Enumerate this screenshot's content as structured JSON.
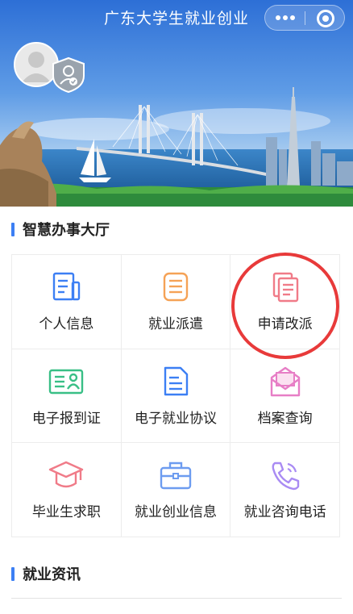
{
  "header": {
    "title": "广东大学生就业创业",
    "more_icon": "more-dots-icon",
    "close_icon": "target-close-icon"
  },
  "profile": {
    "avatar_icon": "user-avatar-icon",
    "badge_icon": "verified-shield-icon"
  },
  "sections": {
    "hall_title": "智慧办事大厅",
    "news_title": "就业资讯"
  },
  "grid": {
    "items": [
      {
        "label": "个人信息",
        "icon": "document-icon",
        "color": "#3c7ff4"
      },
      {
        "label": "就业派遣",
        "icon": "list-document-icon",
        "color": "#f5a256"
      },
      {
        "label": "申请改派",
        "icon": "copy-document-icon",
        "color": "#f07b88"
      },
      {
        "label": "电子报到证",
        "icon": "id-card-icon",
        "color": "#39bf86"
      },
      {
        "label": "电子就业协议",
        "icon": "agreement-document-icon",
        "color": "#3c7ff4"
      },
      {
        "label": "档案查询",
        "icon": "envelope-icon",
        "color": "#e77ec6"
      },
      {
        "label": "毕业生求职",
        "icon": "graduation-cap-icon",
        "color": "#f07b88"
      },
      {
        "label": "就业创业信息",
        "icon": "briefcase-icon",
        "color": "#6d9cf0"
      },
      {
        "label": "就业咨询电话",
        "icon": "phone-icon",
        "color": "#a98bf3"
      }
    ]
  },
  "colors": {
    "accent": "#3c7ff4",
    "highlight": "#e83a3a"
  }
}
